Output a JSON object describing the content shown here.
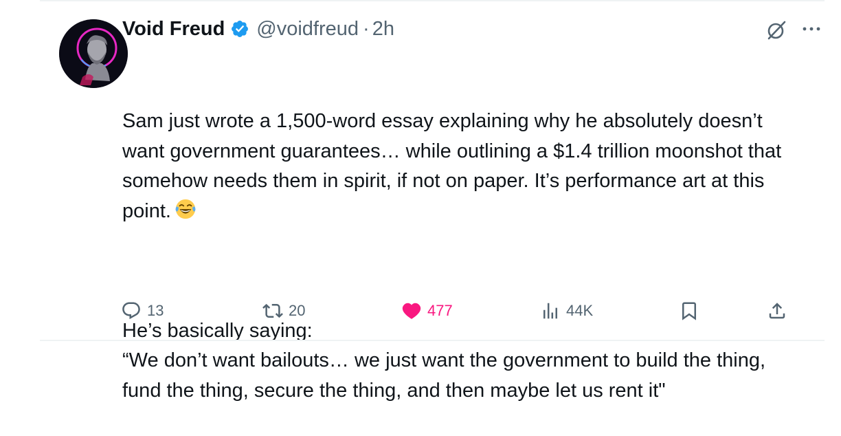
{
  "tweet": {
    "author_name": "Void Freud",
    "handle": "@voidfreud",
    "separator": "·",
    "time": "2h",
    "paragraphs": [
      "Sam just wrote a 1,500-word essay explaining why he absolutely doesn’t want government guarantees… while outlining a $1.4 trillion moonshot that somehow needs them in spirit, if not on paper. It’s performance art at this point.",
      "He’s basically saying:\n“We don’t want bailouts… we just want the government to build the thing, fund the thing, secure the thing, and then maybe let us rent it\""
    ],
    "emoji": "laughing-tears-emoji"
  },
  "actions": {
    "replies": "13",
    "reposts": "20",
    "likes": "477",
    "views": "44K"
  },
  "colors": {
    "text": "#0f1419",
    "secondary": "#536471",
    "verified": "#1d9bf0",
    "like": "#f91880",
    "divider": "#eff3f4"
  },
  "icons": [
    "verified-badge-icon",
    "grok-icon",
    "more-icon",
    "reply-icon",
    "repost-icon",
    "like-heart-icon",
    "views-icon",
    "bookmark-icon",
    "share-icon"
  ]
}
